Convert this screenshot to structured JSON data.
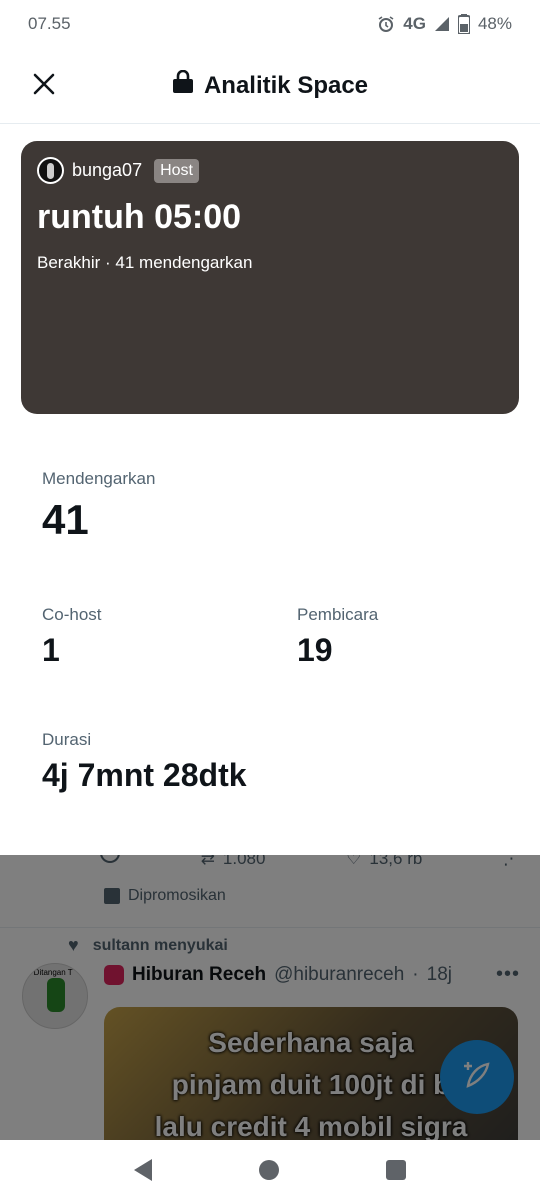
{
  "status_bar": {
    "time": "07.55",
    "network": "4G",
    "battery": "48%",
    "icons": [
      "alarm-icon",
      "signal-icon",
      "battery-icon"
    ]
  },
  "header": {
    "title": "Analitik Space",
    "icons": [
      "close-icon",
      "lock-icon"
    ]
  },
  "space": {
    "host_name": "bunga07",
    "host_badge": "Host",
    "title": "runtuh 05:00",
    "status": "Berakhir · 41 mendengarkan",
    "card_color": "#3e3835"
  },
  "stats": {
    "listeners_label": "Mendengarkan",
    "listeners_value": "41",
    "cohost_label": "Co-host",
    "cohost_value": "1",
    "speakers_label": "Pembicara",
    "speakers_value": "19",
    "duration_label": "Durasi",
    "duration_value": "4j 7mnt 28dtk"
  },
  "background_feed": {
    "retweets": "1.080",
    "likes": "13,6 rb",
    "promoted_label": "Dipromosikan",
    "liked_by": "sultann menyukai",
    "tweet_name": "Hiburan Receh",
    "tweet_handle": "@hiburanreceh",
    "tweet_age": "18j",
    "media_text": [
      "Sederhana saja",
      "pinjam duit 100jt di b",
      "lalu credit 4 mobil sigra"
    ],
    "avatar_text": "n Ditangan T"
  },
  "colors": {
    "accent": "#1d9bf0",
    "text_primary": "#0f1419",
    "text_secondary": "#536471"
  }
}
